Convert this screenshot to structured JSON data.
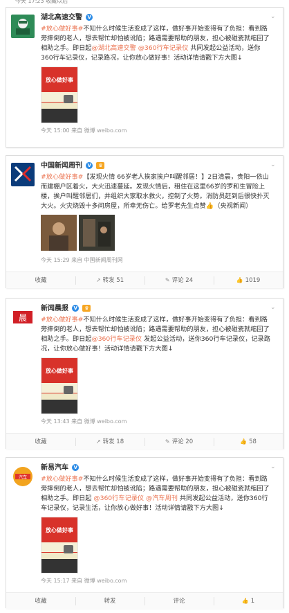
{
  "topstrip": "今天 17:23 收藏以后",
  "posts": [
    {
      "name": "湖北高速交警",
      "badge": "V",
      "text_parts": [
        {
          "t": "#放心做好事#",
          "c": "tag"
        },
        {
          "t": "不知什么时候生活变成了这样，做好事开始变得有了负担：看到路旁摔倒的老人，想去帮忙却怕被讹陷；路遇需要帮助的朋友，担心被碰瓷就缩回了相助之手。即日起",
          "c": ""
        },
        {
          "t": "@湖北高速交警",
          "c": "mention"
        },
        {
          "t": " ",
          "c": ""
        },
        {
          "t": "@360行车记录仪",
          "c": "mention"
        },
        {
          "t": " 共同发起公益活动，送你360行车记录仪，记录路况，让你放心做好事！活动详情请戳下方大图↓",
          "c": ""
        }
      ],
      "promo_title": "放心做好事",
      "meta": "今天 15:00 来自 微博 weibo.com",
      "actions": []
    },
    {
      "name": "中国新闻周刊",
      "badge": "V",
      "crown": "♛",
      "text_parts": [
        {
          "t": "#放心做好事#",
          "c": "tag"
        },
        {
          "t": "【发现火情 66岁老人挨家挨户叫醒邻居！】2日清晨，贵阳一依山而建棚户区着火，大火迅速蔓延。发现火情后，租住在这里66岁的罗和生冒险上楼，挨户叫醒邻居们，并组织大家取水救火，控制了火势。消防员赶到后很快扑灭大火。火灾烧毁十多间房屋，所幸无伤亡。给罗老先生点赞👍（央视新闻）",
          "c": ""
        }
      ],
      "meta": "今天 15:29 来自 中国新闻周刊网",
      "actions": [
        {
          "icon": "☆",
          "label": "收藏"
        },
        {
          "icon": "↗",
          "label": "转发 51"
        },
        {
          "icon": "✎",
          "label": "评论 24"
        },
        {
          "icon": "👍",
          "label": "1019"
        }
      ]
    },
    {
      "name": "新闻晨报",
      "badge": "V",
      "crown": "♛",
      "text_parts": [
        {
          "t": "#放心做好事#",
          "c": "tag"
        },
        {
          "t": "不知什么时候生活变成了这样，做好事开始变得有了负担：看到路旁摔倒的老人，想去帮忙却怕被讹陷；路遇需要帮助的朋友，担心被碰瓷就缩回了相助之手。即日起",
          "c": ""
        },
        {
          "t": "@360行车记录仪",
          "c": "mention"
        },
        {
          "t": " 发起公益活动，送你360行车记录仪，记录路况，让你放心做好事！活动详情请戳下方大图↓",
          "c": ""
        }
      ],
      "promo_title": "放心做好事",
      "meta": "今天 13:43 来自 微博 weibo.com",
      "actions": [
        {
          "icon": "☆",
          "label": "收藏"
        },
        {
          "icon": "↗",
          "label": "转发 18"
        },
        {
          "icon": "✎",
          "label": "评论 20"
        },
        {
          "icon": "👍",
          "label": "58"
        }
      ]
    },
    {
      "name": "新易汽车",
      "badge": "V",
      "text_parts": [
        {
          "t": "#放心做好事#",
          "c": "tag"
        },
        {
          "t": "不知什么时候生活变成了这样，做好事开始变得有了负担：看到路旁摔倒的老人，想去帮忙却怕被讹陷；路遇需要帮助的朋友，担心被碰瓷就缩回了相助之手。即日起 ",
          "c": ""
        },
        {
          "t": "@360行车记录仪",
          "c": "mention"
        },
        {
          "t": " ",
          "c": ""
        },
        {
          "t": "@汽车周刊",
          "c": "mention"
        },
        {
          "t": " 共同发起公益活动，送你360行车记录仪，记录生活，让你放心做好事！活动详情请戳下方大图↓",
          "c": ""
        }
      ],
      "promo_title": "放心做好事",
      "meta": "今天 15:17 来自 微博 weibo.com",
      "actions": [
        {
          "icon": "☆",
          "label": "收藏"
        },
        {
          "icon": "↗",
          "label": "转发"
        },
        {
          "icon": "✎",
          "label": "评论"
        },
        {
          "icon": "👍",
          "label": "1"
        }
      ]
    }
  ],
  "colors": {
    "accent": "#eb7350",
    "verified": "#2b8be6",
    "promo_red": "#d8322a"
  }
}
